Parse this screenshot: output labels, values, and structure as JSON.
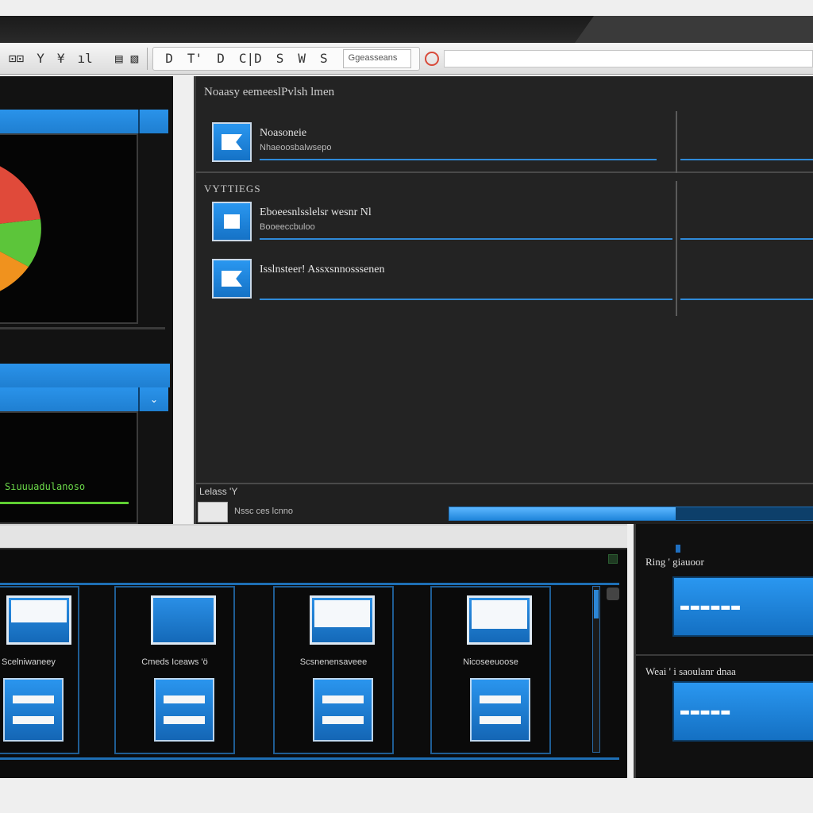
{
  "toolbar": {
    "buttons_left": [
      "⊡⊡",
      "Y",
      "¥",
      "ıl",
      "▤",
      "▧"
    ],
    "buttons_mid": [
      "D",
      "T'",
      "D",
      "C|D",
      "S",
      "W",
      "S"
    ],
    "address_text": "Ggeasseans",
    "icon_names": [
      "layout-icon",
      "filter-icon",
      "yen-icon",
      "chart-icon",
      "list-icon",
      "grid-icon"
    ]
  },
  "left": {
    "panel1_tab_icon": "",
    "panel2_tab_icon": "⌄",
    "green_text": "Sıuuuadulanoso"
  },
  "main": {
    "title": "Noaasy eemeeslPvlsh lmen",
    "section_label": "VYTTIEGS",
    "rows": [
      {
        "title": "Noasoneie",
        "subtitle": "Nhaeoosbalwsepo"
      },
      {
        "title": "Eboeesnlsslelsr wesnr Nl",
        "subtitle": "Booeeccbuloo"
      },
      {
        "title": "Isslnsteer! Assxsnnosssenen",
        "subtitle": ""
      }
    ],
    "status_label": "Lelass 'Y",
    "status_meta": "Nssc ces lcnno",
    "progress": 0.62
  },
  "cards": [
    {
      "caption": "Scelniwaneey"
    },
    {
      "caption": "Cmeds Iceaws 'ö"
    },
    {
      "caption": "Scsnenensaveee"
    },
    {
      "caption": "Nicoseeuoose"
    }
  ],
  "right_panel": {
    "title1": "Ring ' giauoor",
    "box1_text": "▬▬▬▬▬▬",
    "title2": "Weai ' i saoulanr dnaa",
    "box2_text": "▬▬▬▬▬"
  },
  "colors": {
    "accent": "#1f85db",
    "pie": [
      "#e04a3a",
      "#5cc53a",
      "#f0921e"
    ]
  }
}
